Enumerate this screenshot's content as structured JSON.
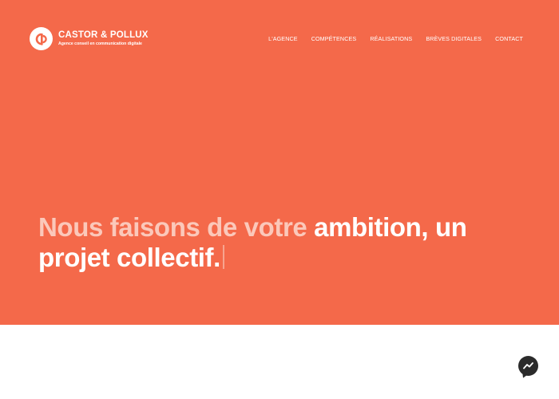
{
  "brand": {
    "name": "CASTOR & POLLUX",
    "tagline": "Agence conseil en communication digitale",
    "logo_icon": "cp-logo-icon"
  },
  "nav": {
    "items": [
      {
        "label": "L'AGENCE"
      },
      {
        "label": "COMPÉTENCES"
      },
      {
        "label": "RÉALISATIONS"
      },
      {
        "label": "BRÈVES DIGITALES"
      },
      {
        "label": "CONTACT"
      }
    ]
  },
  "hero": {
    "headline_dim": "Nous faisons de votre ",
    "headline_bright_1": "ambition, un",
    "headline_bright_2": "projet collectif."
  },
  "chat": {
    "icon": "messenger-icon"
  },
  "colors": {
    "hero_background": "#f4694a",
    "text_primary": "#ffffff",
    "text_dim": "#fbc8ba",
    "chat_button": "#2b2b2b"
  }
}
